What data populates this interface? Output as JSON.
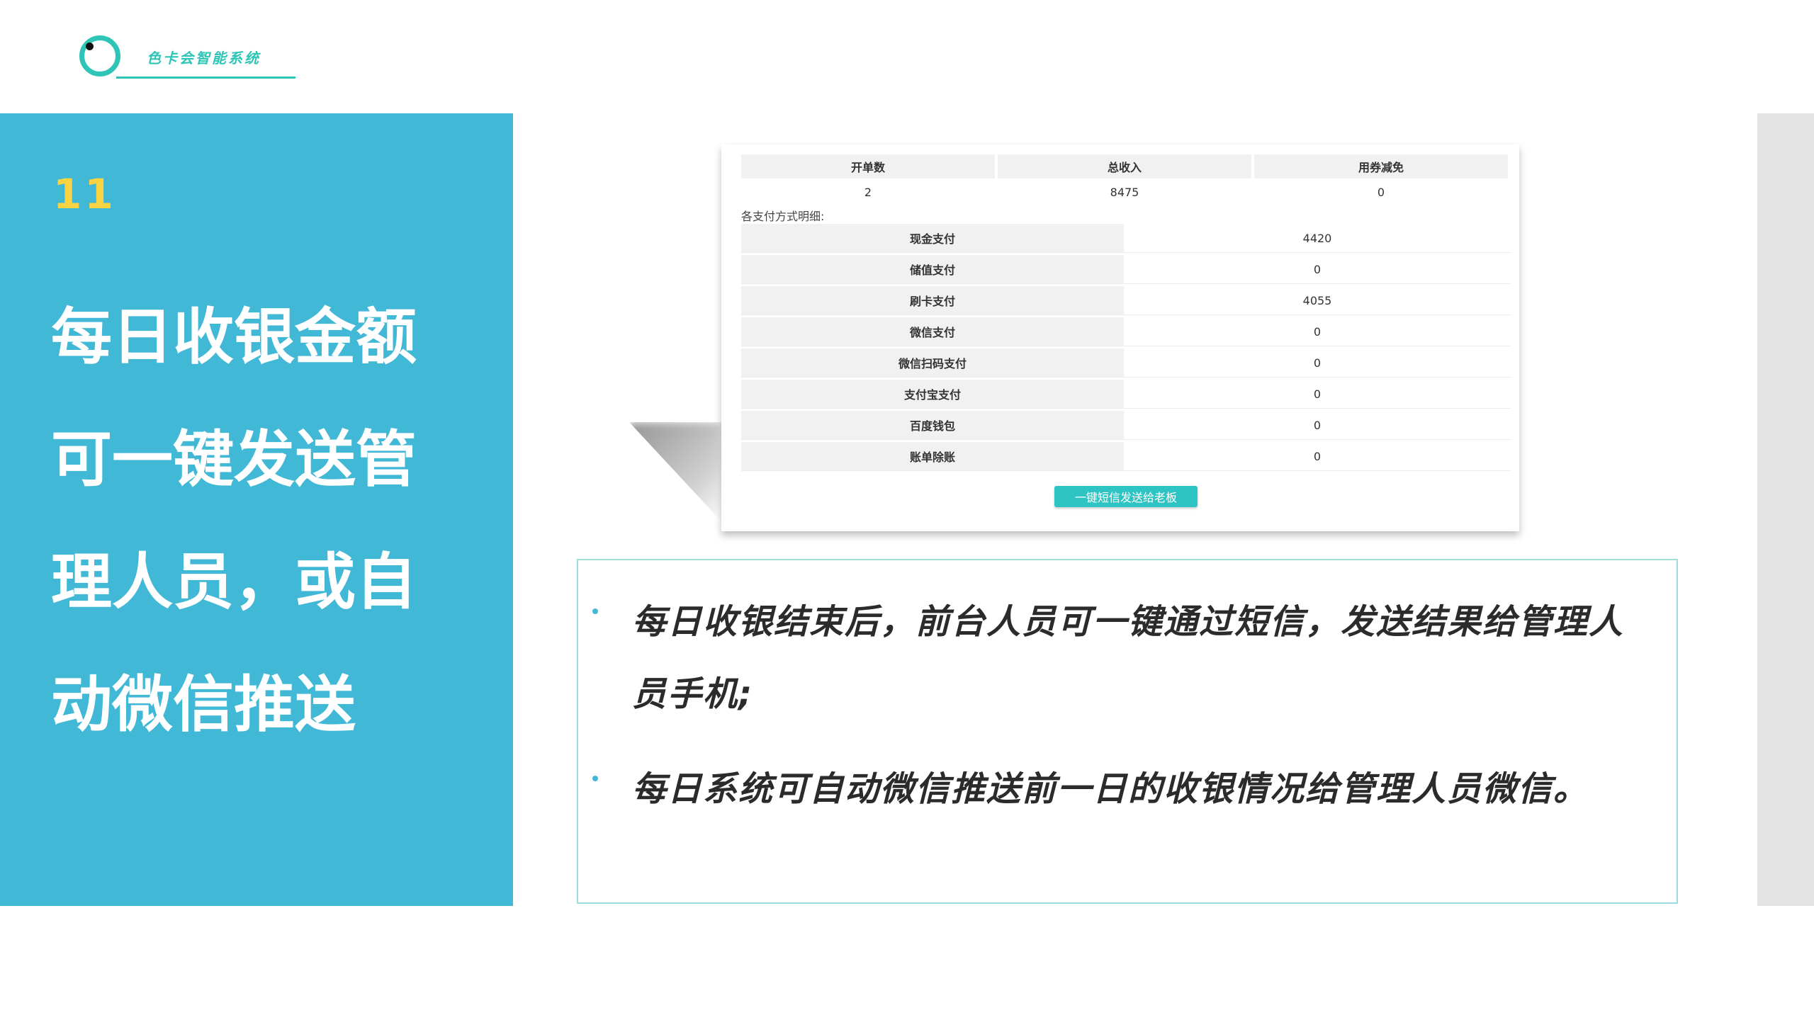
{
  "logo": {
    "text": "色卡会智能系统"
  },
  "panel": {
    "number": "11",
    "title_lines": [
      "每日收银金额",
      "可一键发送管",
      "理人员，或自",
      "动微信推送"
    ]
  },
  "screenshot": {
    "summary_headers": [
      "开单数",
      "总收入",
      "用券减免"
    ],
    "summary_values": [
      "2",
      "8475",
      "0"
    ],
    "breakdown_label": "各支付方式明细:",
    "payments": [
      {
        "name": "现金支付",
        "value": "4420"
      },
      {
        "name": "储值支付",
        "value": "0"
      },
      {
        "name": "刷卡支付",
        "value": "4055"
      },
      {
        "name": "微信支付",
        "value": "0"
      },
      {
        "name": "微信扫码支付",
        "value": "0"
      },
      {
        "name": "支付宝支付",
        "value": "0"
      },
      {
        "name": "百度钱包",
        "value": "0"
      },
      {
        "name": "账单除账",
        "value": "0"
      }
    ],
    "send_button": "一键短信发送给老板"
  },
  "description": {
    "bullets": [
      "每日收银结束后，前台人员可一键通过短信，发送结果给管理人员手机;",
      "每日系统可自动微信推送前一日的收银情况给管理人员微信。"
    ]
  },
  "colors": {
    "panel_blue": "#41b8d5",
    "number_yellow": "#f9d342",
    "accent_teal": "#2ec4b6"
  }
}
